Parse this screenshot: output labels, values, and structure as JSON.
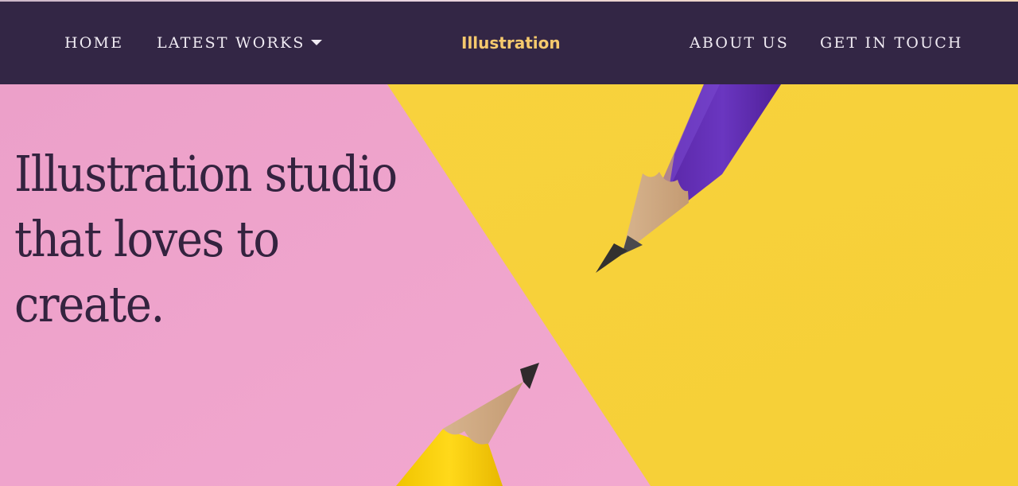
{
  "nav": {
    "home": "HOME",
    "latest_works": "LATEST WORKS",
    "brand": "Illustration",
    "about": "ABOUT US",
    "contact": "GET IN TOUCH"
  },
  "hero": {
    "headline_lines": [
      "Illustration studio",
      "that loves to",
      "create."
    ]
  },
  "colors": {
    "nav_background": "#332645",
    "nav_text": "#f1ecf4",
    "brand": "#f6c96d",
    "hero_pink": "#efa1cb",
    "hero_yellow": "#f7d23c",
    "headline": "#34233f"
  },
  "icons": {
    "dropdown": "caret-down-icon"
  }
}
